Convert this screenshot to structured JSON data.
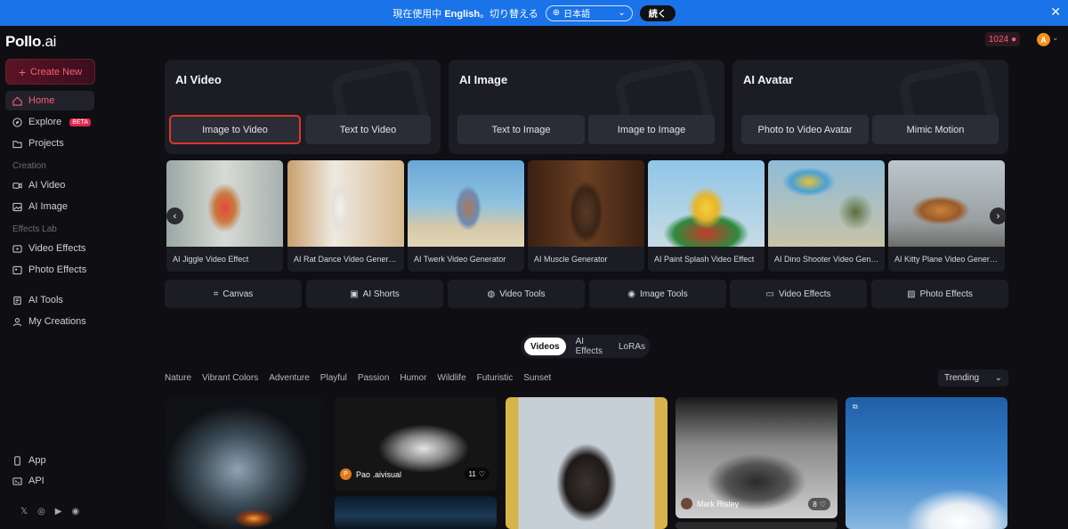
{
  "lang_bar": {
    "message_prefix": "現在使用中",
    "message_lang": "English",
    "message_suffix": "。切り替える",
    "select_value": "日本語",
    "continue_label": "続く",
    "close_label": "✕"
  },
  "sidebar": {
    "logo_main": "Pollo",
    "logo_suffix": ".ai",
    "create_label": "Create New",
    "home": "Home",
    "explore": "Explore",
    "beta": "BETA",
    "projects": "Projects",
    "creation_label": "Creation",
    "ai_video": "AI Video",
    "ai_image": "AI Image",
    "effects_label": "Effects Lab",
    "video_effects": "Video Effects",
    "photo_effects": "Photo Effects",
    "ai_tools": "AI Tools",
    "my_creations": "My Creations",
    "app": "App",
    "api": "API"
  },
  "header": {
    "credits": "1024",
    "avatar_letter": "A"
  },
  "cards": [
    {
      "title": "AI Video",
      "buttons": [
        "Image to Video",
        "Text to Video"
      ]
    },
    {
      "title": "AI Image",
      "buttons": [
        "Text to Image",
        "Image to Image"
      ]
    },
    {
      "title": "AI Avatar",
      "buttons": [
        "Photo to Video Avatar",
        "Mimic Motion"
      ]
    }
  ],
  "carousel": [
    "AI Jiggle Video Effect",
    "AI Rat Dance Video Generator",
    "AI Twerk Video Generator",
    "AI Muscle Generator",
    "AI Paint Splash Video Effect",
    "AI Dino Shooter Video Generator",
    "AI Kitty Plane Video Generator"
  ],
  "tools": [
    "Canvas",
    "AI Shorts",
    "Video Tools",
    "Image Tools",
    "Video Effects",
    "Photo Effects"
  ],
  "media_tabs": [
    "Videos",
    "AI Effects",
    "LoRAs"
  ],
  "filters": [
    "Nature",
    "Vibrant Colors",
    "Adventure",
    "Playful",
    "Passion",
    "Humor",
    "Wildlife",
    "Futuristic",
    "Sunset"
  ],
  "sort_value": "Trending",
  "gallery": {
    "item2_author": "Pao .aivisual",
    "item2_avatar": "P",
    "item2_likes": "11",
    "item4_author": "Mark Risley",
    "item4_likes": "8"
  },
  "colors": {
    "accent": "#ff5a7a",
    "banner": "#1a73e8",
    "highlight_border": "#e0352a"
  }
}
